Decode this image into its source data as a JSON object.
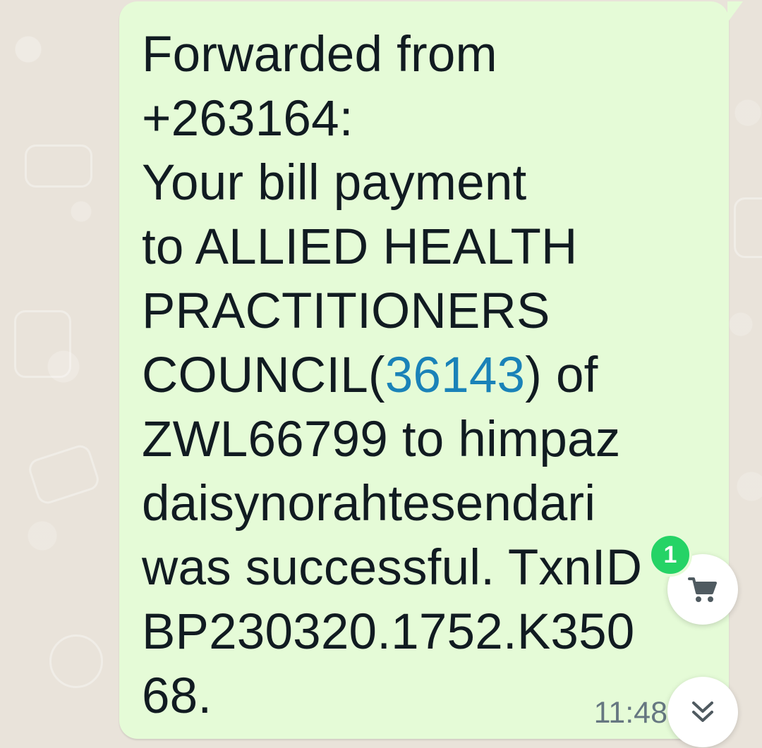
{
  "message": {
    "lines": [
      "Forwarded from",
      "+263164:",
      "Your bill payment",
      "to ALLIED HEALTH",
      "PRACTITIONERS",
      "COUNCIL(",
      "36143",
      ") of",
      "ZWL66799 to himpaz",
      "daisynorahtesendari",
      "was successful. TxnID",
      "BP230320.1752.K350",
      "68."
    ],
    "timestamp": "11:48"
  },
  "cart_badge": {
    "count": "1"
  },
  "colors": {
    "bubble": "#e5fbd7",
    "wallpaper": "#e9e3da",
    "text": "#111b21",
    "link": "#1a82b8",
    "badge": "#25d366",
    "timestamp": "#667781"
  },
  "icons": {
    "cart": "shopping-cart-icon",
    "scroll": "double-chevron-down-icon",
    "tick": "read-receipt-tick-icon"
  }
}
